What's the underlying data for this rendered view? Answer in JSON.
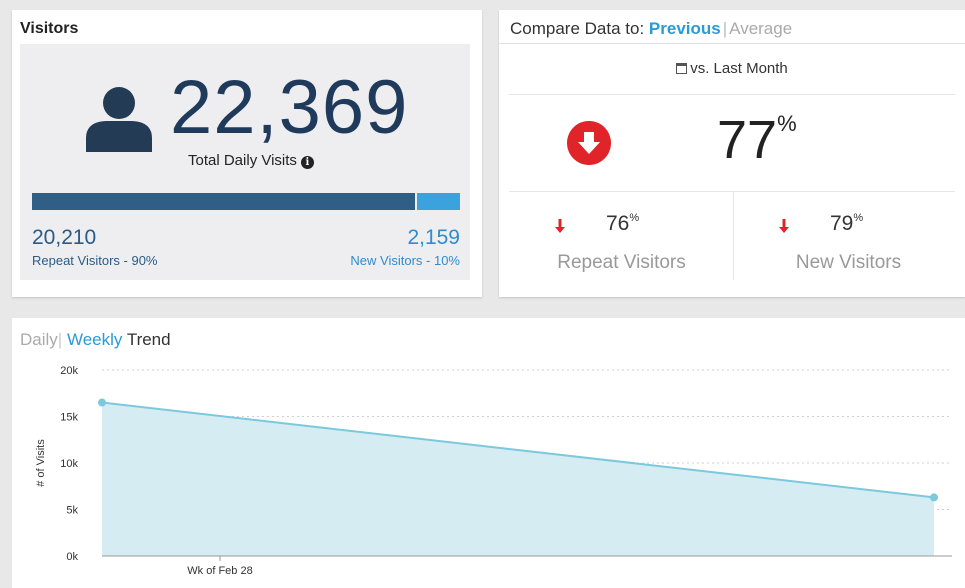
{
  "visitors": {
    "title": "Visitors",
    "total": "22,369",
    "total_label": "Total Daily Visits",
    "repeat_count": "20,210",
    "repeat_label": "Repeat Visitors - 90%",
    "new_count": "2,159",
    "new_label": "New Visitors - 10%",
    "repeat_share": 0.9,
    "new_share": 0.1
  },
  "compare": {
    "prefix": "Compare Data to:",
    "option_previous": "Previous",
    "separator": "|",
    "option_average": "Average",
    "period": "vs. Last Month",
    "main_value": "77",
    "pct_symbol": "%",
    "repeat_value": "76",
    "repeat_label": "Repeat Visitors",
    "new_value": "79",
    "new_label": "New Visitors"
  },
  "trend": {
    "tab_daily": "Daily",
    "separator": "|",
    "tab_weekly": "Weekly",
    "title_rest": "Trend"
  },
  "colors": {
    "accent_blue": "#2a9bd6",
    "repeat_bar": "#2f5f86",
    "new_bar": "#3ba2dc",
    "down_red": "#e02429",
    "area_fill": "#d5ecf3",
    "line_color": "#7cc8dc"
  },
  "icons": {
    "person": "person-icon",
    "info": "info-icon",
    "calendar": "calendar-icon",
    "down_circle": "arrow-down-circle-icon",
    "down_arrow": "arrow-down-icon"
  },
  "chart_data": {
    "type": "area",
    "ylabel": "# of Visits",
    "xlabel": "",
    "ylim": [
      0,
      20000
    ],
    "yticks": [
      0,
      5000,
      10000,
      15000,
      20000
    ],
    "ytick_labels": [
      "0k",
      "5k",
      "10k",
      "15k",
      "20k"
    ],
    "xticks": [
      "Wk of Feb 28"
    ],
    "grid": true,
    "series": [
      {
        "values": [
          16500,
          6300
        ]
      }
    ]
  }
}
